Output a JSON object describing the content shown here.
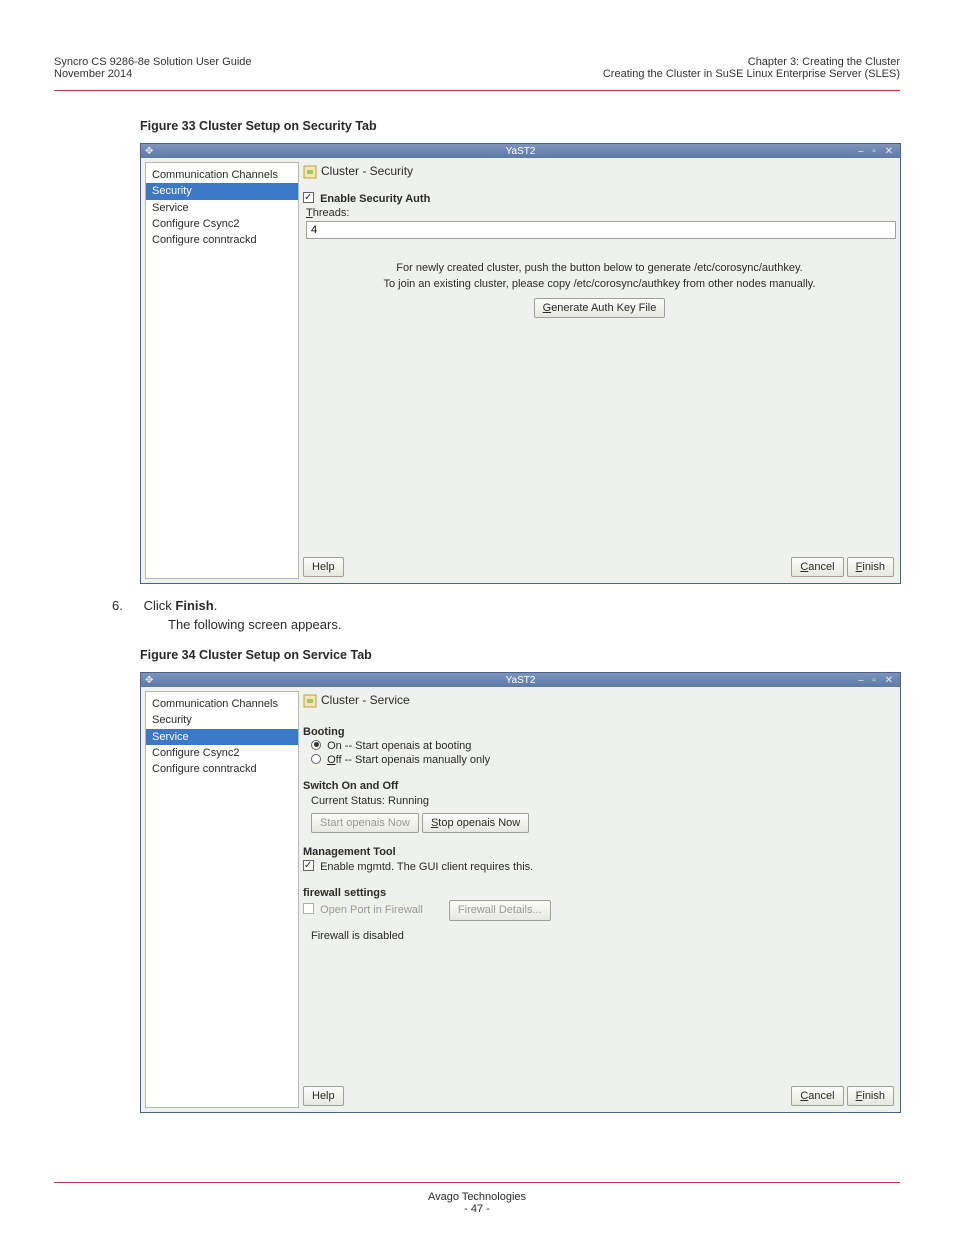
{
  "header": {
    "left1": "Syncro CS 9286-8e Solution User Guide",
    "left2": "November 2014",
    "right1": "Chapter 3: Creating the Cluster",
    "right2": "Creating the Cluster in SuSE Linux Enterprise Server (SLES)"
  },
  "fig33": {
    "caption": "Figure 33  Cluster Setup on Security Tab",
    "titlebar": "YaST2",
    "sidebar": {
      "items": [
        "Communication Channels",
        "Security",
        "Service",
        "Configure Csync2",
        "Configure conntrackd"
      ],
      "selected_index": 1
    },
    "heading": "Cluster - Security",
    "enable_checkbox_label": "Enable Security Auth",
    "threads_label": "Threads:",
    "threads_value": "4",
    "msg1": "For newly created cluster, push the button below to generate /etc/corosync/authkey.",
    "msg2": "To join an existing cluster, please copy /etc/corosync/authkey from other nodes manually.",
    "gen_btn": "Generate Auth Key File",
    "help": "Help",
    "cancel": "Cancel",
    "finish": "Finish"
  },
  "steps": {
    "s6num": "6.",
    "s6_prefix": "Click ",
    "s6_bold": "Finish",
    "s6_suffix": ".",
    "s6_desc": "The following screen appears."
  },
  "fig34": {
    "caption": "Figure 34  Cluster Setup on Service Tab",
    "titlebar": "YaST2",
    "sidebar": {
      "items": [
        "Communication Channels",
        "Security",
        "Service",
        "Configure Csync2",
        "Configure conntrackd"
      ],
      "selected_index": 2
    },
    "heading": "Cluster - Service",
    "booting_label": "Booting",
    "boot_opt_on": "On -- Start openais at booting",
    "boot_opt_off": "Off -- Start openais manually only",
    "switch_label": "Switch On and Off",
    "status_label": "Current Status:   Running",
    "start_btn": "Start openais Now",
    "stop_btn": "Stop openais Now",
    "mgmt_label": "Management Tool",
    "mgmt_cb": "Enable mgmtd. The GUI client requires this.",
    "fw_label": "firewall settings",
    "fw_cb": "Open Port in Firewall",
    "fw_details": "Firewall Details...",
    "fw_status": "Firewall is disabled",
    "help": "Help",
    "cancel": "Cancel",
    "finish": "Finish"
  },
  "footer": {
    "company": "Avago Technologies",
    "page": "- 47 -"
  }
}
